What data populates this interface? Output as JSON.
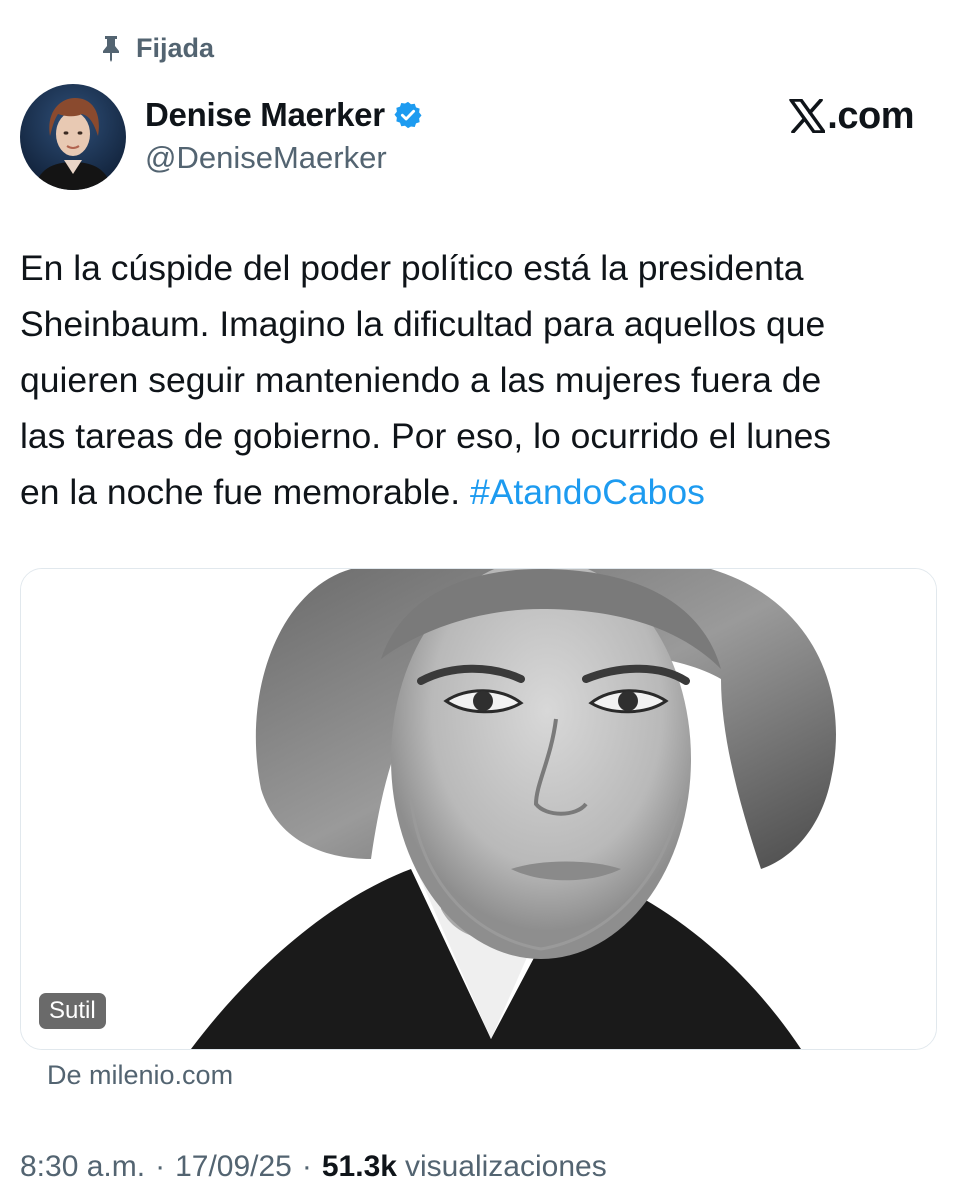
{
  "pinned": {
    "label": "Fijada"
  },
  "author": {
    "name": "Denise Maerker",
    "handle": "@DeniseMaerker",
    "verified": true,
    "verified_color": "#1d9bf0"
  },
  "brand": {
    "text": ".com"
  },
  "tweet": {
    "lines": [
      "En la cúspide del poder político está la presidenta",
      "Sheinbaum. Imagino la dificultad para aquellos que",
      "quieren seguir manteniendo a las mujeres fuera de",
      "las tareas de gobierno. Por eso, lo ocurrido el lunes",
      "en la noche fue memorable. "
    ],
    "hashtag": "#AtandoCabos",
    "hashtag_color": "#1d9bf0"
  },
  "card": {
    "tag": "Sutil",
    "source": "De milenio.com"
  },
  "meta": {
    "time": "8:30 a.m.",
    "date": "17/09/25",
    "separator": "·",
    "views_count": "51.3k",
    "views_label": "visualizaciones"
  },
  "icons": {
    "pin": "pin-icon",
    "verified": "verified-badge-icon",
    "brand_logo": "x-logo-icon"
  }
}
